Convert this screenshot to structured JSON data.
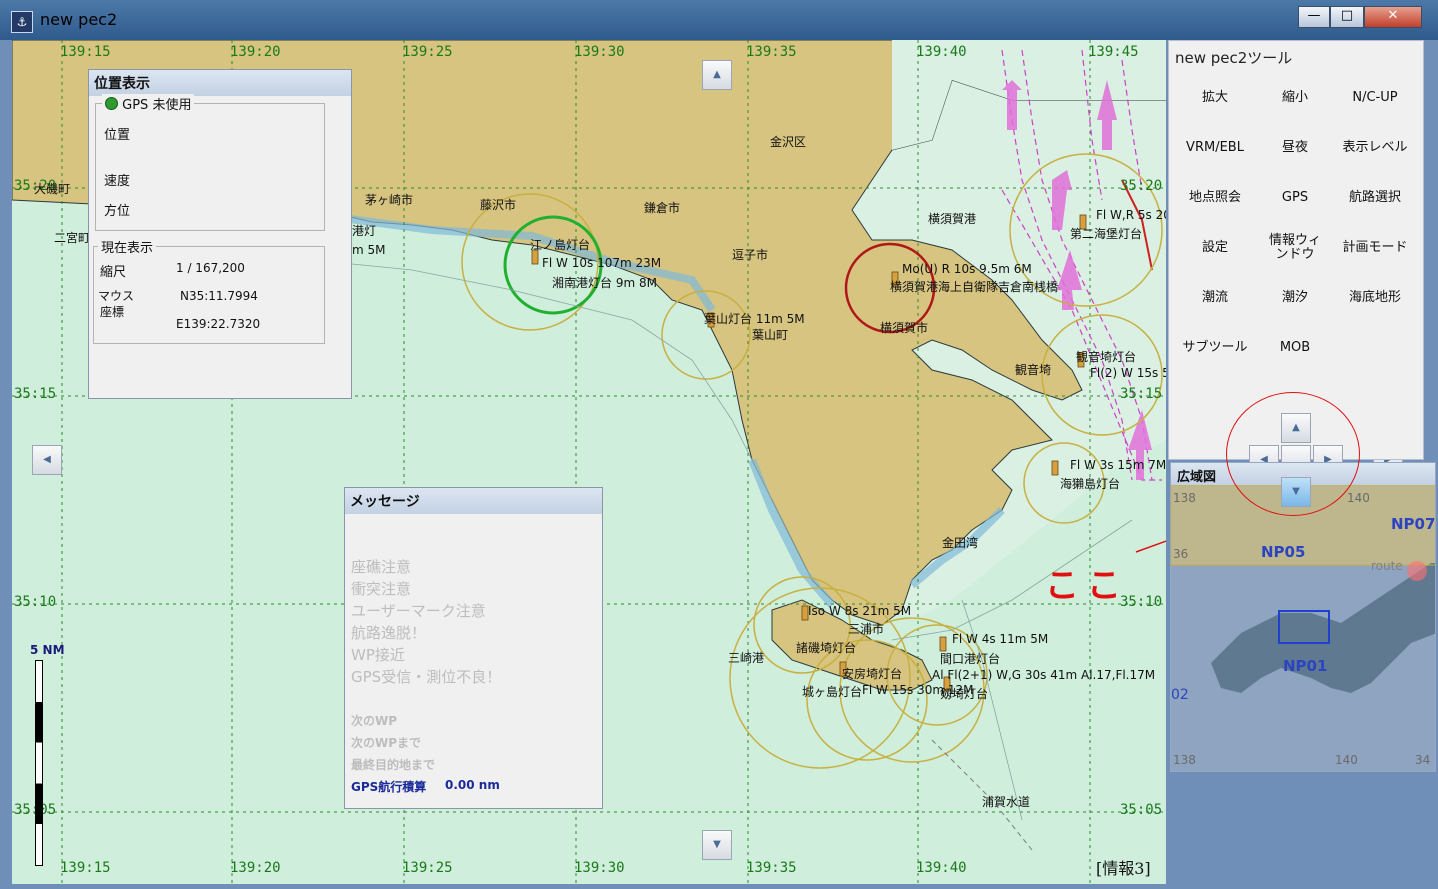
{
  "window": {
    "title": "new pec2",
    "minimize": "—",
    "maximize": "□",
    "close": "✕"
  },
  "map": {
    "lon_labels_top": [
      "139:15",
      "139:20",
      "139:25",
      "139:30",
      "139:35",
      "139:40",
      "139:45"
    ],
    "lon_labels_bottom": [
      "139:15",
      "139:20",
      "139:25",
      "139:30",
      "139:35",
      "139:40"
    ],
    "lat_labels_left": [
      "35:20",
      "35:15",
      "35:10",
      "35:05"
    ],
    "lat_labels_right": [
      "35:20",
      "35:15",
      "35:10",
      "35:05"
    ],
    "places": {
      "kanazawa": "金沢区",
      "chigasaki": "茅ヶ崎市",
      "fujisawa": "藤沢市",
      "kamakura": "鎌倉市",
      "zushi": "逗子市",
      "yokosuka_bay": "横須賀港",
      "yokosuka_city": "横須賀市",
      "hayama": "葉山町",
      "kannonzaki": "観音埼",
      "kaneda": "金田湾",
      "miura": "三浦市",
      "misaki": "三崎港",
      "uraga": "浦賀水道",
      "ninomiya": "二宮町",
      "oiso": "大磯町"
    },
    "lights": {
      "enoshima": "江ノ島灯台",
      "enoshima_ch": "Fl W 10s 107m 23M",
      "shonan": "湘南港灯台 9m 8M",
      "hayama_light": "葉山灯台 11m 5M",
      "yokosuka_light": "Mo(U) R 10s 9.5m 6M",
      "jsdf": "横須賀港海上自衛隊吉倉南桟橋",
      "daini": "第二海堡灯台",
      "daini_ch": "Fl W,R 5s 20m",
      "kannon_light": "観音埼灯台",
      "kannon_ch": "Fl(2) W 15s 5",
      "umihotaru": "海獺島灯台",
      "umihotaru_ch": "Fl W 3s 15m 7M",
      "moroiso": "諸磯埼灯台",
      "moroiso_ch": "Iso W 8s 21m 5M",
      "awa": "安房埼灯台",
      "jogashima": "城ヶ島灯台",
      "jogashima_ch": "Fl W 15s 30m 12M",
      "tsurugi": "剱埼灯台",
      "tsurugi_ch": "Al Fl(2+1) W,G 30s 41m Al.17,Fl.17M",
      "mamiana": "間口港灯台",
      "mamiana_ch": "Fl W 4s 11m 5M",
      "partial_left": "港灯",
      "partial_left2": "m 5M"
    },
    "scale_label": "5 NM",
    "info_label": "[情報3]",
    "annotation": "ここ"
  },
  "position_panel": {
    "title": "位置表示",
    "gps_group": "GPS 未使用",
    "gps_status_color": "#2e9b2e",
    "position_label": "位置",
    "speed_label": "速度",
    "heading_label": "方位",
    "display_group": "現在表示",
    "scale_label": "縮尺",
    "scale_value": "1 / 167,200",
    "mouse_label": "マウス",
    "coord_label": "座標",
    "lat_value": "N35:11.7994",
    "lon_value": "E139:22.7320"
  },
  "message_panel": {
    "title": "メッセージ",
    "alerts": [
      "座礁注意",
      "衝突注意",
      "ユーザーマーク注意",
      "航路逸脱！",
      "WP接近",
      "GPS受信・測位不良！"
    ],
    "next_wp": "次のWP",
    "next_wp_to": "次のWPまで",
    "final_dest": "最終目的地まで",
    "gps_total_label": "GPS航行積算",
    "gps_total_value": "0.00 nm"
  },
  "tools": {
    "title": "new pec2ツール",
    "buttons": [
      "拡大",
      "縮小",
      "N/C-UP",
      "VRM/EBL",
      "昼夜",
      "表示レベル",
      "地点照会",
      "GPS",
      "航路選択",
      "設定",
      "情報ウィンドウ",
      "計画モード",
      "潮流",
      "潮汐",
      "海底地形",
      "サブツール",
      "MOB"
    ]
  },
  "overview": {
    "title": "広域図",
    "labels": [
      "NP07",
      "NP05",
      "NP01",
      "route",
      "02"
    ],
    "ticks": [
      "138",
      "140",
      "36",
      "34",
      "138",
      "140",
      "34"
    ]
  }
}
